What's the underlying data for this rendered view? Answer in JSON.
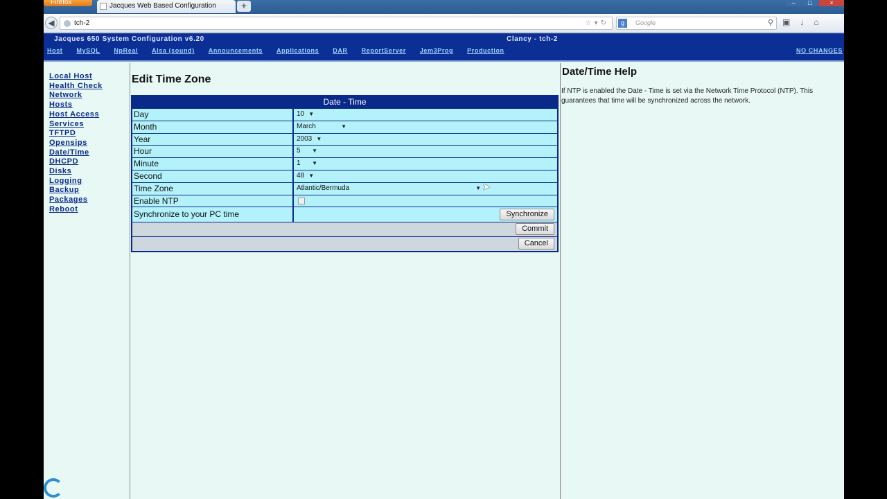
{
  "browser": {
    "firefox_label": "Firefox",
    "tab_title": "Jacques Web Based Configuration",
    "new_tab": "+",
    "url": "tch-2",
    "search_placeholder": "Google",
    "win_minimize": "–",
    "win_maximize": "□",
    "win_close": "×"
  },
  "header": {
    "app_title": "Jacques 650 System Configuration v6.20",
    "host_title": "Clancy - tch-2",
    "nav": [
      "Host",
      "MySQL",
      "NpReal",
      "Alsa (sound)",
      "Announcements",
      "Applications",
      "DAR",
      "ReportServer",
      "Jem3Prog",
      "Production"
    ],
    "status": "NO CHANGES"
  },
  "sidebar": {
    "items": [
      "Local Host",
      "Health Check",
      "Network",
      "Hosts",
      "Host Access",
      "Services",
      "TFTPD",
      "Opensips",
      "Date/Time",
      "DHCPD",
      "Disks",
      "Logging",
      "Backup",
      "Packages",
      "Reboot"
    ]
  },
  "main": {
    "title": "Edit Time Zone",
    "form_header": "Date - Time",
    "fields": {
      "day": {
        "label": "Day",
        "value": "10"
      },
      "month": {
        "label": "Month",
        "value": "March"
      },
      "year": {
        "label": "Year",
        "value": "2003"
      },
      "hour": {
        "label": "Hour",
        "value": "5"
      },
      "minute": {
        "label": "Minute",
        "value": "1"
      },
      "second": {
        "label": "Second",
        "value": "48"
      },
      "timezone": {
        "label": "Time Zone",
        "value": "Atlantic/Bermuda"
      },
      "ntp": {
        "label": "Enable NTP",
        "checked": false
      },
      "sync": {
        "label": "Synchronize to your PC time",
        "button": "Synchronize"
      }
    },
    "commit_label": "Commit",
    "cancel_label": "Cancel"
  },
  "help": {
    "title": "Date/Time Help",
    "text": "If NTP is enabled the Date - Time is set via the Network Time Protocol (NTP). This guarantees that time will be synchronized across the network."
  },
  "colors": {
    "header_bg": "#0b2f95",
    "row_bg": "#b3f2fb",
    "link": "#0a2a8a",
    "page_bg": "#e8f8f5"
  }
}
